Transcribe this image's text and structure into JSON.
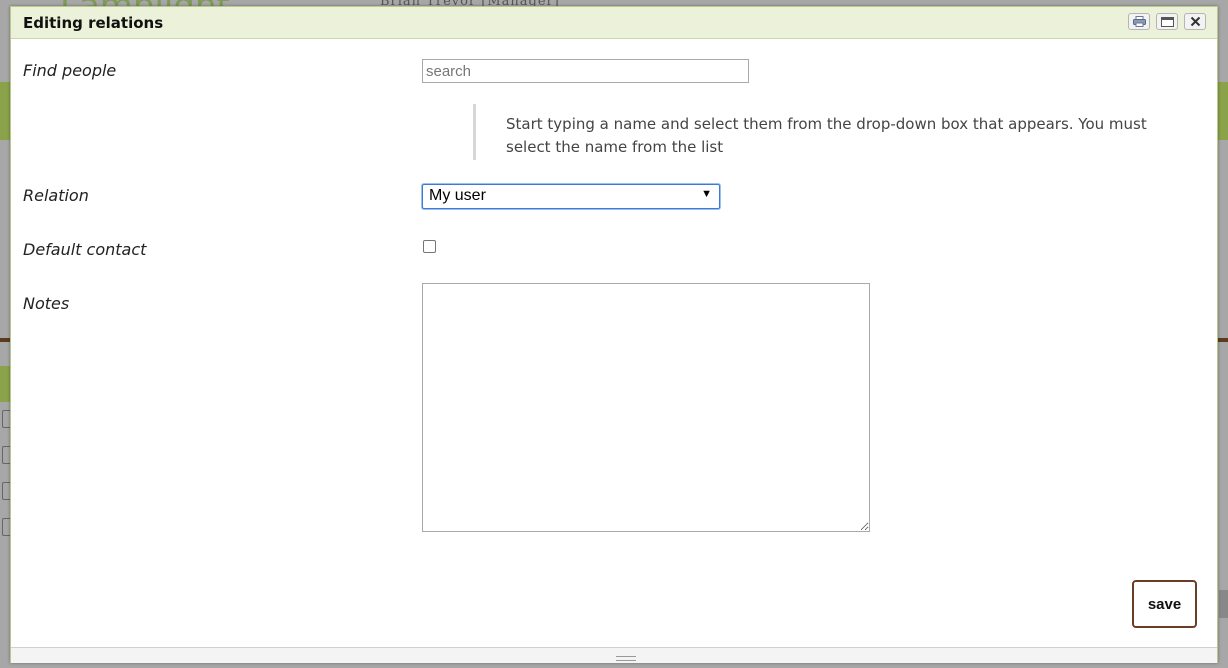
{
  "background": {
    "logo_text": "Lamplight",
    "user_text": "Brian Trevor [Manager]"
  },
  "dialog": {
    "title": "Editing relations",
    "titlebar_icons": [
      "print-icon",
      "maximize-icon",
      "close-icon"
    ]
  },
  "form": {
    "find_people": {
      "label": "Find people",
      "placeholder": "search",
      "value": ""
    },
    "hint": "Start typing a name and select them from the drop-down box that appears. You must select the name from the list",
    "relation": {
      "label": "Relation",
      "selected": "My user"
    },
    "default_contact": {
      "label": "Default contact",
      "checked": false
    },
    "notes": {
      "label": "Notes",
      "value": ""
    },
    "save_label": "save"
  },
  "colors": {
    "titlebar_bg": "#ebf2d9",
    "save_border": "#6b3d26",
    "select_focus": "#3b7bd4"
  }
}
